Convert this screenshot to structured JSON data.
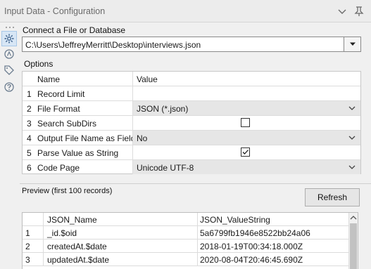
{
  "window": {
    "title": "Input Data - Configuration",
    "pin_icon": "pin-icon",
    "collapse_icon": "chevron-down-icon"
  },
  "sidebar": {
    "icons": [
      "settings-gear-icon",
      "annotation-icon",
      "tag-icon",
      "help-icon"
    ]
  },
  "connect": {
    "label": "Connect a File or Database",
    "path": "C:\\Users\\JeffreyMerritt\\Desktop\\interviews.json"
  },
  "options": {
    "label": "Options",
    "header": {
      "name": "Name",
      "value": "Value"
    },
    "rows": [
      {
        "num": "1",
        "name": "Record Limit",
        "value": "",
        "type": "text"
      },
      {
        "num": "2",
        "name": "File Format",
        "value": "JSON (*.json)",
        "type": "combo"
      },
      {
        "num": "3",
        "name": "Search SubDirs",
        "value": "",
        "type": "checkbox",
        "checked": false
      },
      {
        "num": "4",
        "name": "Output File Name as Field",
        "value": "No",
        "type": "combo"
      },
      {
        "num": "5",
        "name": "Parse Value as String",
        "value": "",
        "type": "checkbox",
        "checked": true
      },
      {
        "num": "6",
        "name": "Code Page",
        "value": "Unicode UTF-8",
        "type": "combo"
      }
    ]
  },
  "preview": {
    "label": "Preview (first 100 records)",
    "refresh_label": "Refresh",
    "columns": [
      "",
      "JSON_Name",
      "JSON_ValueString"
    ],
    "rows": [
      [
        "1",
        "_id.$oid",
        "5a6799fb1946e8522bb24a06"
      ],
      [
        "2",
        "createdAt.$date",
        "2018-01-19T00:34:18.000Z"
      ],
      [
        "3",
        "updatedAt.$date",
        "2020-08-04T20:46:45.690Z"
      ]
    ]
  }
}
